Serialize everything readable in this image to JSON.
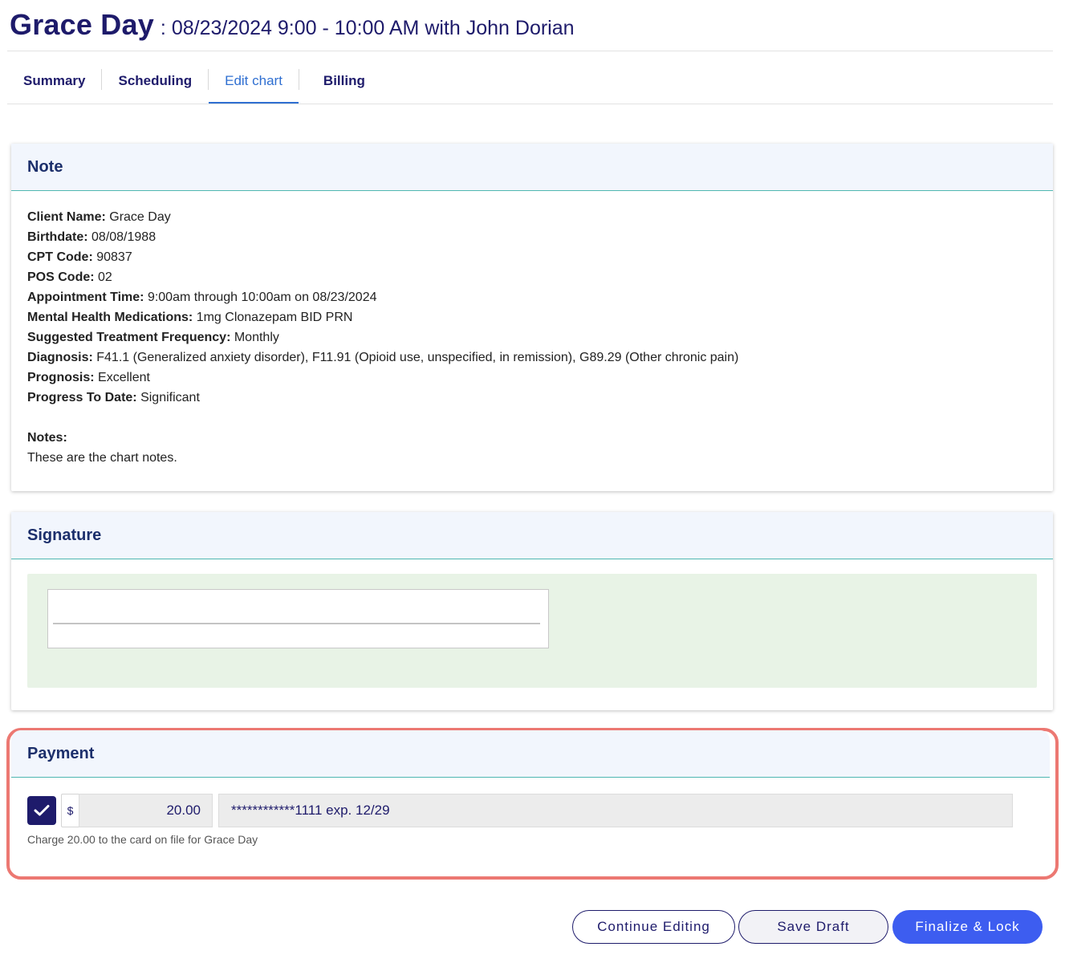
{
  "header": {
    "client_name": "Grace Day",
    "appointment_info": ": 08/23/2024 9:00 - 10:00 AM with John Dorian"
  },
  "tabs": [
    {
      "label": "Summary",
      "active": false
    },
    {
      "label": "Scheduling",
      "active": false
    },
    {
      "label": "Edit chart",
      "active": true
    },
    {
      "label": "Billing",
      "active": false
    }
  ],
  "note": {
    "title": "Note",
    "fields": [
      {
        "label": "Client Name:",
        "value": "Grace Day"
      },
      {
        "label": "Birthdate:",
        "value": "08/08/1988"
      },
      {
        "label": "CPT Code:",
        "value": "90837"
      },
      {
        "label": "POS Code:",
        "value": "02"
      },
      {
        "label": "Appointment Time:",
        "value": "9:00am through 10:00am on 08/23/2024"
      },
      {
        "label": "Mental Health Medications:",
        "value": "1mg Clonazepam BID PRN"
      },
      {
        "label": "Suggested Treatment Frequency:",
        "value": "Monthly"
      },
      {
        "label": "Diagnosis:",
        "value": "F41.1 (Generalized anxiety disorder), F11.91 (Opioid use, unspecified, in remission), G89.29 (Other chronic pain)"
      },
      {
        "label": "Prognosis:",
        "value": "Excellent"
      },
      {
        "label": "Progress To Date:",
        "value": "Significant"
      }
    ],
    "notes_label": "Notes:",
    "notes_text": "These are the chart notes."
  },
  "signature": {
    "title": "Signature"
  },
  "payment": {
    "title": "Payment",
    "charge_checked": true,
    "currency_symbol": "$",
    "amount": "20.00",
    "card": "************1111 exp. 12/29",
    "help_text": "Charge 20.00 to the card on file for Grace Day"
  },
  "actions": {
    "continue_label": "Continue Editing",
    "draft_label": "Save Draft",
    "finalize_label": "Finalize & Lock"
  },
  "colors": {
    "primary_navy": "#1e1b6b",
    "tab_active": "#2f6fd1",
    "finalize_blue": "#3d5df0",
    "highlight_red": "#ec7872",
    "signature_bg": "#e8f3e6"
  }
}
